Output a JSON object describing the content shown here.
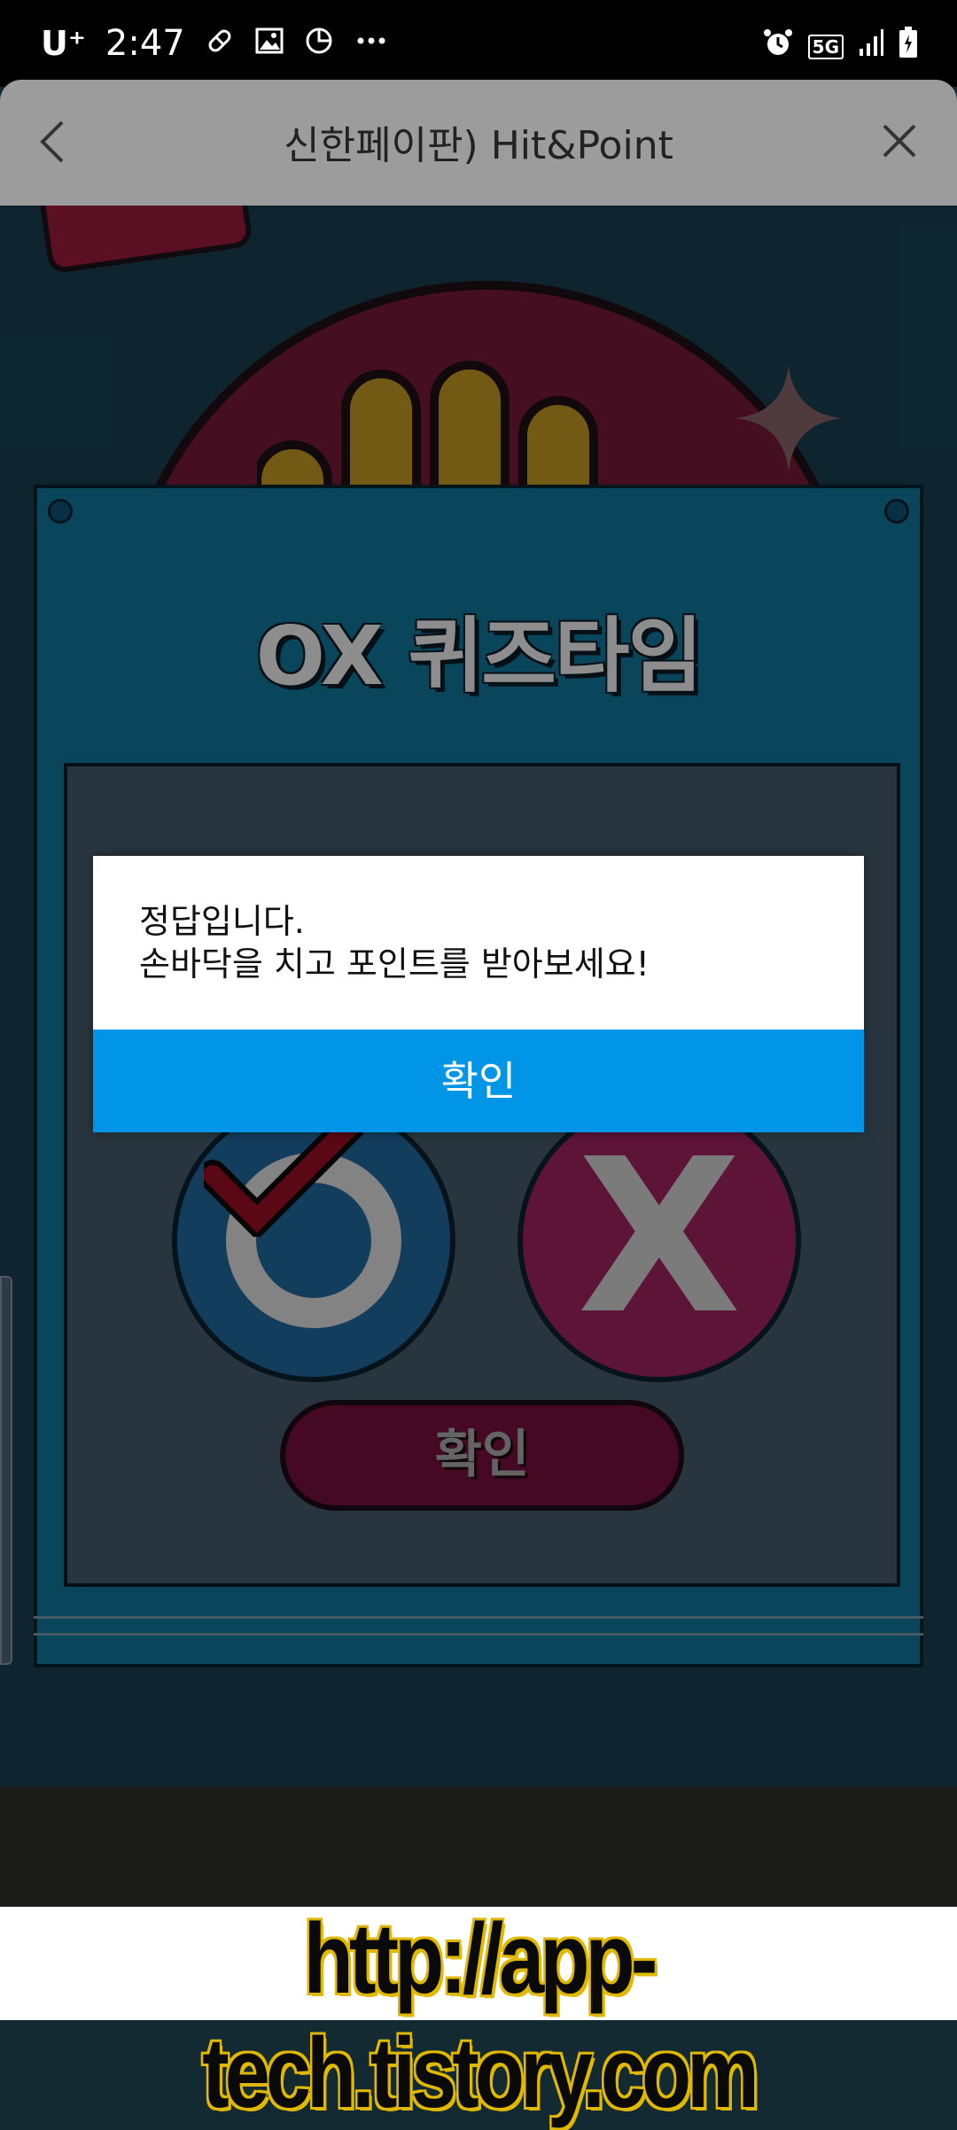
{
  "status_bar": {
    "carrier": "U⁺",
    "time": "2:47",
    "network": "5G",
    "notification_icons": [
      "pill-icon",
      "image-icon",
      "pie-chart-icon",
      "more-icon"
    ],
    "system_icons": [
      "alarm-icon",
      "5g-icon",
      "signal-icon",
      "battery-icon"
    ]
  },
  "app_bar": {
    "title": "신한페이판) Hit&Point",
    "back_icon": "chevron-left-icon",
    "close_icon": "close-icon"
  },
  "quiz_panel": {
    "title": "OX 퀴즈타임",
    "option_o": "O",
    "option_x": "X",
    "selected_option": "O",
    "confirm_label": "확인"
  },
  "dialog": {
    "message_line1": "정답입니다.",
    "message_line2": "손바닥을 치고 포인트를 받아보세요!",
    "ok_label": "확인",
    "ok_color": "#0095e6"
  },
  "watermark": {
    "text": "http://app-tech.tistory.com"
  }
}
